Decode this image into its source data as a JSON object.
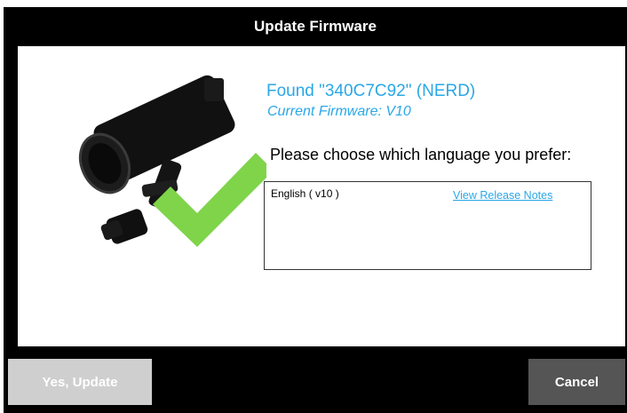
{
  "dialog": {
    "title": "Update Firmware"
  },
  "device": {
    "found_text": "Found \"340C7C92\" (NERD)",
    "firmware_text": "Current Firmware: V10"
  },
  "language": {
    "prompt": "Please choose which language you prefer:",
    "options": [
      {
        "label": "English ( v10 )",
        "link_label": "View Release Notes"
      }
    ]
  },
  "buttons": {
    "update_label": "Yes, Update",
    "update_enabled": false,
    "cancel_label": "Cancel"
  },
  "colors": {
    "accent": "#2aa7e6",
    "check": "#7fd44a",
    "dialog_bg": "#000000"
  },
  "icons": {
    "illustration": "camera-with-checkmark-icon"
  }
}
